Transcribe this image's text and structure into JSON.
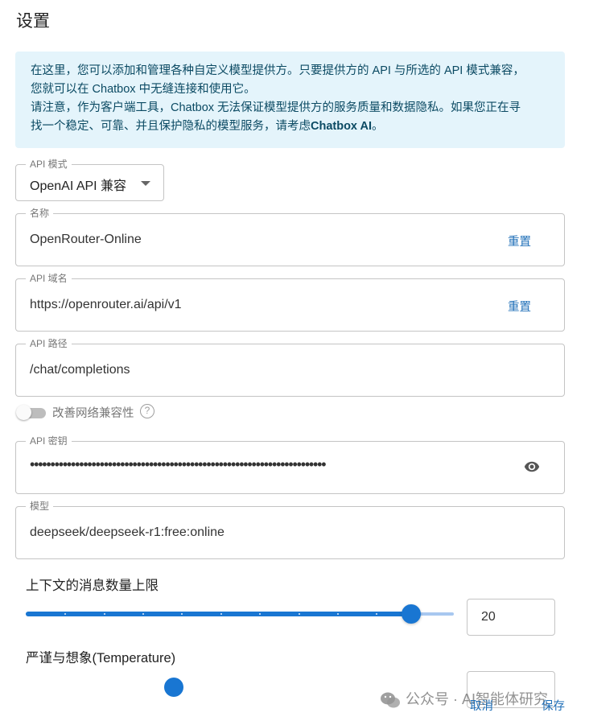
{
  "page": {
    "title": "设置"
  },
  "info": {
    "line1": "在这里，您可以添加和管理各种自定义模型提供方。只要提供方的 API 与所选的 API 模式兼容，",
    "line2": "您就可以在 Chatbox 中无缝连接和使用它。",
    "line3": "请注意，作为客户端工具，Chatbox 无法保证模型提供方的服务质量和数据隐私。如果您正在寻",
    "line4_pre": "找一个稳定、可靠、并且保护隐私的模型服务，请考虑",
    "line4_bold": "Chatbox AI",
    "line4_post": "。"
  },
  "api_mode": {
    "label": "API 模式",
    "value": "OpenAI API 兼容"
  },
  "name_field": {
    "label": "名称",
    "value": "OpenRouter-Online",
    "action": "重置"
  },
  "host_field": {
    "label": "API 域名",
    "value": "https://openrouter.ai/api/v1",
    "action": "重置"
  },
  "path_field": {
    "label": "API 路径",
    "value": "/chat/completions"
  },
  "network_toggle": {
    "label": "改善网络兼容性",
    "checked": false,
    "help": "?"
  },
  "key_field": {
    "label": "API 密钥",
    "value": "••••••••••••••••••••••••••••••••••••••••••••••••••••••••••••••••••••••••"
  },
  "model_field": {
    "label": "模型",
    "value": "deepseek/deepseek-r1:free:online"
  },
  "context_limit": {
    "label": "上下文的消息数量上限",
    "value": "20",
    "fraction": 0.9
  },
  "temperature": {
    "label": "严谨与想象(Temperature)"
  },
  "footer": {
    "cancel": "取消",
    "save": "保存"
  },
  "watermark": {
    "text": "公众号 · AI智能体研究"
  },
  "colors": {
    "accent": "#1976d2",
    "info_bg": "#e4f4fb",
    "info_text": "#0b4a63",
    "link": "#1f6fb8"
  },
  "icons": {
    "eye": "eye-icon",
    "dropdown": "chevron-down-icon",
    "help": "help-circle-icon",
    "wechat": "wechat-icon"
  }
}
